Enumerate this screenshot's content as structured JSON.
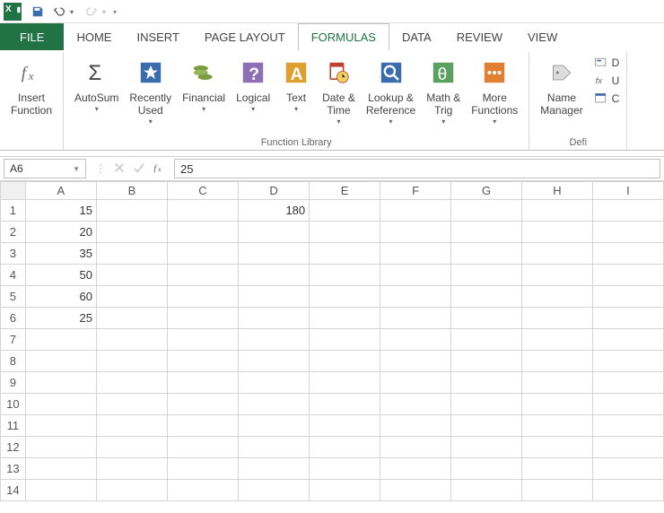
{
  "qat": {
    "save": "save-icon",
    "undo": "undo-icon",
    "redo": "redo-icon"
  },
  "tabs": {
    "file": "FILE",
    "home": "HOME",
    "insert": "INSERT",
    "page_layout": "PAGE LAYOUT",
    "formulas": "FORMULAS",
    "data": "DATA",
    "review": "REVIEW",
    "view": "VIEW"
  },
  "ribbon": {
    "insert_function": "Insert\nFunction",
    "autosum": "AutoSum",
    "recently_used": "Recently\nUsed",
    "financial": "Financial",
    "logical": "Logical",
    "text": "Text",
    "date_time": "Date &\nTime",
    "lookup_ref": "Lookup &\nReference",
    "math_trig": "Math &\nTrig",
    "more_functions": "More\nFunctions",
    "function_library_label": "Function Library",
    "name_manager": "Name\nManager",
    "define_name": "D",
    "use_in_formula": "U",
    "create_from_sel": "C",
    "defined_names_label": "Defi"
  },
  "formula_bar": {
    "cell_ref": "A6",
    "formula_value": "25"
  },
  "grid": {
    "columns": [
      "A",
      "B",
      "C",
      "D",
      "E",
      "F",
      "G",
      "H",
      "I"
    ],
    "rows": [
      "1",
      "2",
      "3",
      "4",
      "5",
      "6",
      "7",
      "8",
      "9",
      "10",
      "11",
      "12",
      "13",
      "14"
    ],
    "cells": {
      "A1": "15",
      "A2": "20",
      "A3": "35",
      "A4": "50",
      "A5": "60",
      "A6": "25",
      "D1": "180"
    }
  }
}
